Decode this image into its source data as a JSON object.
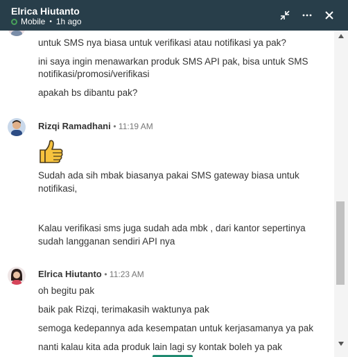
{
  "header": {
    "name": "Elrica Hiutanto",
    "status": "Mobile",
    "last_seen": "1h ago",
    "status_color": "#48a15a",
    "bg_color": "#283e4a"
  },
  "thread": {
    "top_lines": [
      "untuk SMS nya biasa untuk verifikasi atau notifikasi ya pak?",
      "ini saya ingin menawarkan produk SMS API pak, bisa untuk SMS",
      "notifikasi/promosi/verifikasi",
      "apakah bs dibantu pak?"
    ],
    "messages": [
      {
        "sender": "Rizqi Ramadhani",
        "time": "• 11:19 AM",
        "emoji": "thumbs-up",
        "lines": [
          "Sudah ada sih mbak biasanya pakai SMS gateway biasa untuk",
          "notifikasi,",
          "Kalau verifikasi sms juga sudah ada mbk , dari kantor sepertinya",
          "sudah langganan sendiri API nya"
        ]
      },
      {
        "sender": "Elrica Hiutanto",
        "time": "• 11:23 AM",
        "lines": [
          "oh begitu pak",
          "baik pak Rizqi, terimakasih waktunya pak",
          "semoga kedepannya ada kesempatan untuk kerjasamanya ya pak",
          "nanti kalau kita ada produk lain lagi sy kontak boleh ya pak"
        ]
      }
    ]
  }
}
